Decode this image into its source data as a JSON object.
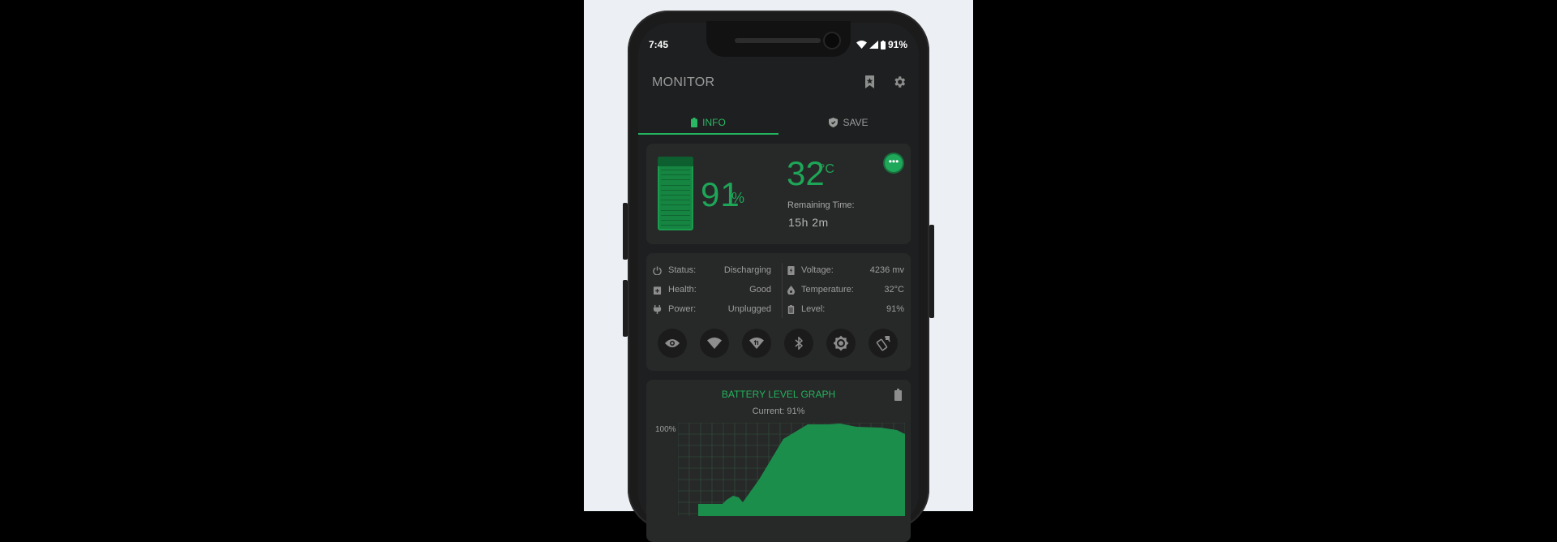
{
  "status_bar": {
    "time": "7:45",
    "battery_percent": "91%"
  },
  "app": {
    "title": "MONITOR"
  },
  "tabs": [
    {
      "label": "INFO",
      "active": true
    },
    {
      "label": "SAVE",
      "active": false
    }
  ],
  "battery_card": {
    "level_number": "91",
    "level_unit": "%",
    "level_fraction": 0.91,
    "temperature_number": "32",
    "temperature_unit": "°C",
    "remaining_label": "Remaining Time:",
    "remaining_value": "15h 2m"
  },
  "details": {
    "left": [
      {
        "icon": "power-icon",
        "label": "Status:",
        "value": "Discharging"
      },
      {
        "icon": "clipboard-plus-icon",
        "label": "Health:",
        "value": "Good"
      },
      {
        "icon": "plug-icon",
        "label": "Power:",
        "value": "Unplugged"
      }
    ],
    "right": [
      {
        "icon": "voltage-icon",
        "label": "Voltage:",
        "value": "4236 mv"
      },
      {
        "icon": "thermometer-drop-icon",
        "label": "Temperature:",
        "value": "32°C"
      },
      {
        "icon": "battery-small-icon",
        "label": "Level:",
        "value": "91%"
      }
    ]
  },
  "quick_toggles": [
    "eye-icon",
    "wifi-icon",
    "mobile-data-icon",
    "bluetooth-icon",
    "brightness-icon",
    "auto-rotate-icon"
  ],
  "graph": {
    "title": "BATTERY LEVEL GRAPH",
    "current_label": "Current:",
    "current_value": "91%",
    "y_label_top": "100%"
  },
  "colors": {
    "accent": "#22b45d",
    "background": "#1e1f20",
    "card": "#272828"
  }
}
